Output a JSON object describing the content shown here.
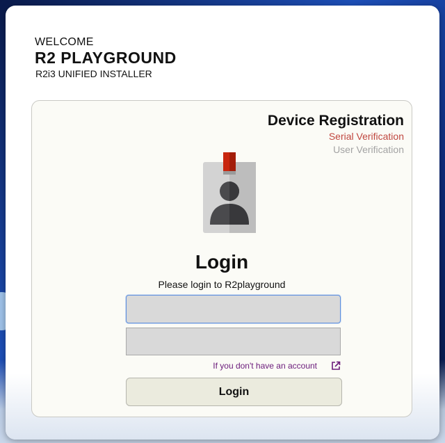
{
  "header": {
    "welcome": "WELCOME",
    "title": "R2 PLAYGROUND",
    "subtitle": "R2i3 UNIFIED INSTALLER"
  },
  "registration": {
    "title": "Device Registration",
    "steps": [
      {
        "label": "Serial Verification",
        "state": "active"
      },
      {
        "label": "User Verification",
        "state": "inactive"
      }
    ]
  },
  "login": {
    "title": "Login",
    "subtitle": "Please login to R2playground",
    "username_value": "",
    "password_value": "",
    "account_link": "If you don't have an account",
    "button_label": "Login"
  },
  "icons": {
    "badge": "id-badge-icon",
    "external_link": "external-link-icon"
  },
  "colors": {
    "step_active": "#c0473f",
    "step_inactive": "#a3a3a3",
    "link": "#6a1a7a",
    "badge_clip": "#c8260f"
  }
}
